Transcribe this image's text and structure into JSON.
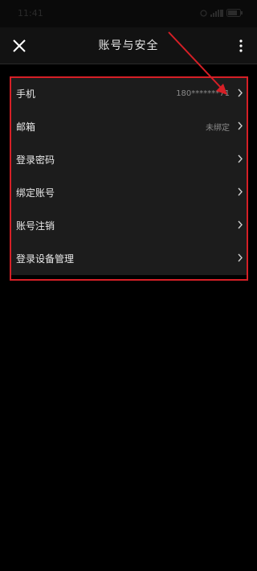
{
  "status_bar": {
    "time": "11:41"
  },
  "header": {
    "title": "账号与安全"
  },
  "settings": {
    "items": [
      {
        "label": "手机",
        "value": "180*******71"
      },
      {
        "label": "邮箱",
        "value": "未绑定"
      },
      {
        "label": "登录密码",
        "value": ""
      },
      {
        "label": "绑定账号",
        "value": ""
      },
      {
        "label": "账号注销",
        "value": ""
      },
      {
        "label": "登录设备管理",
        "value": ""
      }
    ]
  },
  "colors": {
    "background": "#000000",
    "list_background": "#1c1c1c",
    "annotation": "#d61f26"
  },
  "icons": {
    "close": "close-icon",
    "more": "more-vertical-icon",
    "chevron": "chevron-right-icon"
  }
}
